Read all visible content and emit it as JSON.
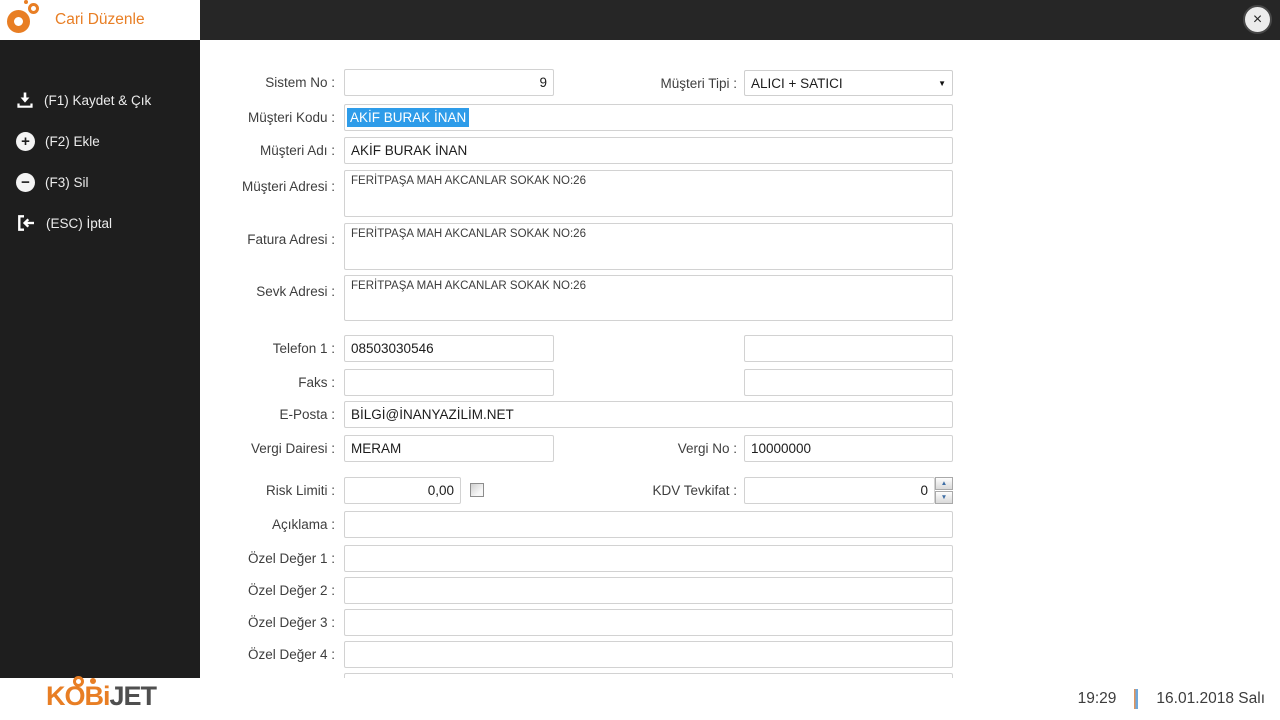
{
  "header": {
    "title": "Cari Düzenle"
  },
  "icons": {
    "close_glyph": "×",
    "plus_glyph": "+",
    "minus_glyph": "−",
    "dropdown_caret": "▼",
    "spinner_up": "▲",
    "spinner_down": "▼"
  },
  "sidebar": {
    "items": [
      {
        "label": "(F1) Kaydet & Çık"
      },
      {
        "label": "(F2) Ekle"
      },
      {
        "label": "(F3) Sil"
      },
      {
        "label": "(ESC) İptal"
      }
    ]
  },
  "form": {
    "sistem_no": {
      "label": "Sistem No :",
      "value": "9"
    },
    "musteri_tipi": {
      "label": "Müşteri Tipi :",
      "value": "ALICI + SATICI"
    },
    "musteri_kodu": {
      "label": "Müşteri Kodu :",
      "value": "AKİF BURAK İNAN",
      "selected": true
    },
    "musteri_adi": {
      "label": "Müşteri Adı :",
      "value": "AKİF BURAK İNAN"
    },
    "musteri_adresi": {
      "label": "Müşteri Adresi :",
      "value": "FERİTPAŞA MAH AKCANLAR SOKAK NO:26"
    },
    "fatura_adresi": {
      "label": "Fatura Adresi :",
      "value": "FERİTPAŞA MAH AKCANLAR SOKAK NO:26"
    },
    "sevk_adresi": {
      "label": "Sevk Adresi :",
      "value": "FERİTPAŞA MAH AKCANLAR SOKAK NO:26"
    },
    "telefon1": {
      "label": "Telefon 1 :",
      "value": "08503030546"
    },
    "telefon2": {
      "value": ""
    },
    "faks": {
      "label": "Faks :",
      "value": ""
    },
    "faks2": {
      "value": ""
    },
    "eposta": {
      "label": "E-Posta :",
      "value": "BİLGİ@İNANYAZİLİM.NET"
    },
    "vergi_dairesi": {
      "label": "Vergi Dairesi :",
      "value": "MERAM"
    },
    "vergi_no": {
      "label": "Vergi No :",
      "value": "10000000"
    },
    "risk_limiti": {
      "label": "Risk Limiti :",
      "value": "0,00",
      "checkbox_checked": false
    },
    "kdv_tevkifat": {
      "label": "KDV Tevkifat :",
      "value": "0"
    },
    "aciklama": {
      "label": "Açıklama :",
      "value": ""
    },
    "ozel_deger_1": {
      "label": "Özel Değer 1 :",
      "value": ""
    },
    "ozel_deger_2": {
      "label": "Özel Değer 2 :",
      "value": ""
    },
    "ozel_deger_3": {
      "label": "Özel Değer 3 :",
      "value": ""
    },
    "ozel_deger_4": {
      "label": "Özel Değer 4 :",
      "value": ""
    }
  },
  "footer": {
    "brand_kobi": "KOBi",
    "brand_jet": "JET",
    "time": "19:29",
    "date": "16.01.2018 Salı"
  },
  "colors": {
    "accent_orange": "#E87E24",
    "selection_blue": "#2E9CE9",
    "topbar_dark": "#262626",
    "sidebar_dark": "#1E1E1E"
  }
}
